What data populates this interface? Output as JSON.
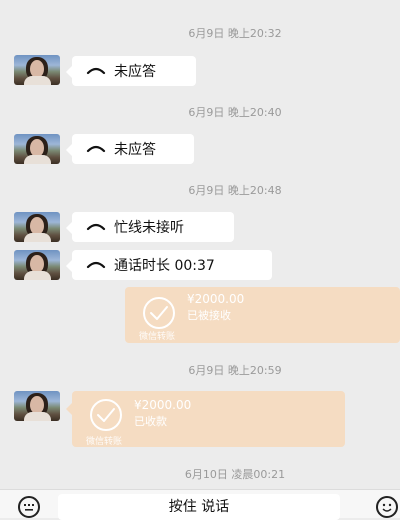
{
  "messages": [
    {
      "time": "6月9日 晚上20:32",
      "text": "未应答"
    },
    {
      "time": "6月9日 晚上20:40",
      "text": "未应答"
    },
    {
      "time": "6月9日 晚上20:48",
      "text": "忙线未接听"
    },
    {
      "text": "通话时长 00:37"
    }
  ],
  "transfers": [
    {
      "amount": "¥2000.00",
      "status": "已被接收",
      "footer": "微信转账"
    },
    {
      "time": "6月9日 晚上20:59",
      "amount": "¥2000.00",
      "status": "已收款",
      "footer": "微信转账"
    }
  ],
  "last_time": "6月10日 凌晨00:21",
  "bottom": {
    "talk_label": "按住 说话"
  },
  "colors": {
    "background": "#ececec",
    "bubble": "#ffffff",
    "transfer": "#f5dcc2"
  }
}
